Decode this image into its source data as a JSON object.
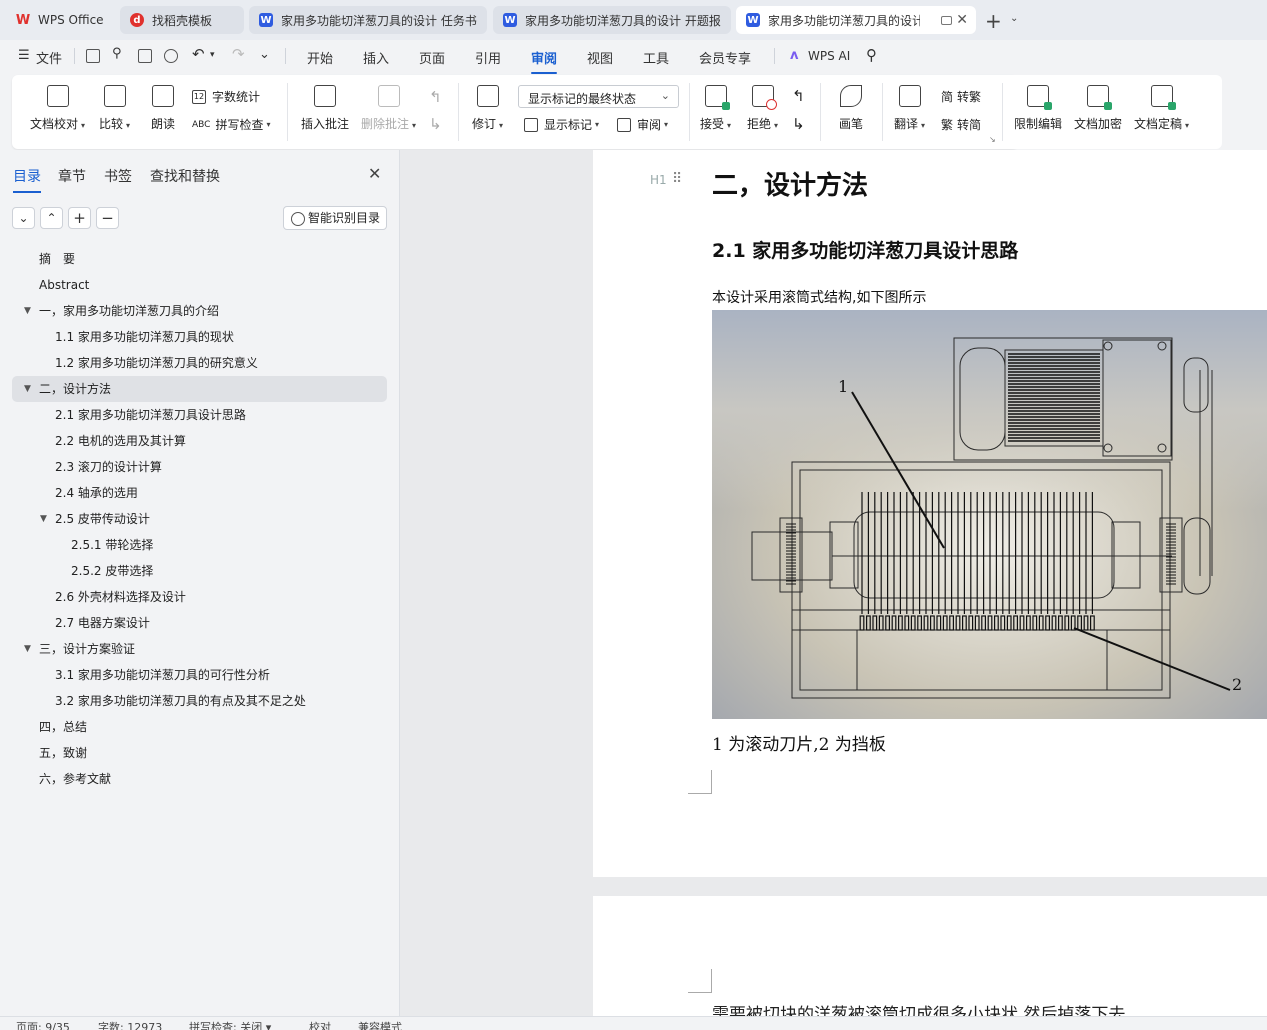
{
  "tabs": [
    {
      "label": "WPS Office",
      "icon": "wps-logo-icon",
      "color": "#e0312d"
    },
    {
      "label": "找稻壳模板",
      "icon": "docer-icon",
      "color": "#e0312d"
    },
    {
      "label": "家用多功能切洋葱刀具的设计 任务书",
      "icon": "word-doc-icon",
      "color": "#2f5ce0"
    },
    {
      "label": "家用多功能切洋葱刀具的设计 开题报",
      "icon": "word-doc-icon",
      "color": "#2f5ce0"
    },
    {
      "label": "家用多功能切洋葱刀具的设计",
      "icon": "word-doc-icon",
      "color": "#2f5ce0"
    }
  ],
  "menu": {
    "file": "文件",
    "items": [
      "开始",
      "插入",
      "页面",
      "引用",
      "审阅",
      "视图",
      "工具",
      "会员专享"
    ],
    "active": "审阅",
    "ai": "WPS AI"
  },
  "ribbon": {
    "doc_check": "文档校对",
    "compare": "比较",
    "read_aloud": "朗读",
    "word_count": "字数统计",
    "spell_check": "拼写检查",
    "insert_comment": "插入批注",
    "delete_comment": "删除批注",
    "revise": "修订",
    "markup_state": "显示标记的最终状态",
    "show_markup": "显示标记",
    "review": "审阅",
    "accept": "接受",
    "reject": "拒绝",
    "pen": "画笔",
    "translate": "翻译",
    "to_traditional": "转繁",
    "to_simplified": "转简",
    "restrict_edit": "限制编辑",
    "encrypt": "文档加密",
    "finalize": "文档定稿",
    "word_count_icon_text": "12",
    "spell_icon_text": "ABC",
    "trad_icon_text": "简",
    "simp_icon_text": "繁"
  },
  "sidebar": {
    "tabs": [
      "目录",
      "章节",
      "书签",
      "查找和替换"
    ],
    "smart_button": "智能识别目录",
    "toc": [
      {
        "label": "摘　要",
        "level": 0,
        "arrow": ""
      },
      {
        "label": "Abstract",
        "level": 0,
        "arrow": ""
      },
      {
        "label": "一，家用多功能切洋葱刀具的介绍",
        "level": 0,
        "arrow": "▼"
      },
      {
        "label": "1.1 家用多功能切洋葱刀具的现状",
        "level": 1,
        "arrow": ""
      },
      {
        "label": "1.2 家用多功能切洋葱刀具的研究意义",
        "level": 1,
        "arrow": ""
      },
      {
        "label": "二，设计方法",
        "level": 0,
        "arrow": "▼",
        "selected": true
      },
      {
        "label": "2.1 家用多功能切洋葱刀具设计思路",
        "level": 1,
        "arrow": ""
      },
      {
        "label": "2.2 电机的选用及其计算",
        "level": 1,
        "arrow": ""
      },
      {
        "label": "2.3 滚刀的设计计算",
        "level": 1,
        "arrow": ""
      },
      {
        "label": "2.4 轴承的选用",
        "level": 1,
        "arrow": ""
      },
      {
        "label": "2.5 皮带传动设计",
        "level": 1,
        "arrow": "▼"
      },
      {
        "label": "2.5.1 带轮选择",
        "level": 2,
        "arrow": ""
      },
      {
        "label": "2.5.2 皮带选择",
        "level": 2,
        "arrow": ""
      },
      {
        "label": "2.6 外壳材料选择及设计",
        "level": 1,
        "arrow": ""
      },
      {
        "label": "2.7 电器方案设计",
        "level": 1,
        "arrow": ""
      },
      {
        "label": "三，设计方案验证",
        "level": 0,
        "arrow": "▼"
      },
      {
        "label": "3.1 家用多功能切洋葱刀具的可行性分析",
        "level": 1,
        "arrow": ""
      },
      {
        "label": "3.2 家用多功能切洋葱刀具的有点及其不足之处",
        "level": 1,
        "arrow": ""
      },
      {
        "label": "四，总结",
        "level": 0,
        "arrow": ""
      },
      {
        "label": "五，致谢",
        "level": 0,
        "arrow": ""
      },
      {
        "label": "六，参考文献",
        "level": 0,
        "arrow": ""
      }
    ]
  },
  "document": {
    "heading1": "二，设计方法",
    "heading_marker": "H1",
    "heading2": "2.1 家用多功能切洋葱刀具设计思路",
    "paragraph": "本设计采用滚筒式结构,如下图所示",
    "figure_label_1": "1",
    "figure_label_2": "2",
    "caption": "1 为滚动刀片,2 为挡板",
    "page2_text": "需要被切块的洋葱被滚筒切成很多小块状 然后掉落下去"
  },
  "status": {
    "page": "页面: 9/35",
    "words": "字数: 12973",
    "spell": "拼写检查: 关闭",
    "proof": "校对",
    "compat": "兼容模式"
  },
  "colors": {
    "accent": "#1a5fd0",
    "wps_red": "#e0312d",
    "word_blue": "#2f5ce0"
  }
}
